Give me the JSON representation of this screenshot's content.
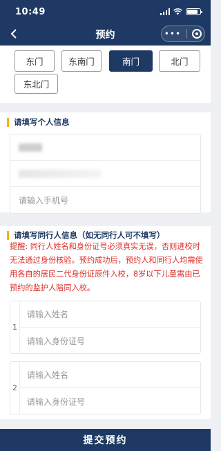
{
  "status": {
    "time": "10:49"
  },
  "nav": {
    "title": "预约",
    "more_label": "•••"
  },
  "gates": {
    "options": [
      "东门",
      "东南门",
      "南门",
      "北门",
      "东北门"
    ],
    "selected": "南门"
  },
  "personal": {
    "title": "请填写个人信息",
    "phone_placeholder": "请输入手机号"
  },
  "companion": {
    "title": "请填写同行人信息（如无同行人可不填写）",
    "notice": "提醒: 同行人姓名和身份证号必须真实无误，否则进校时无法通过身份核验。预约成功后，预约人和同行人均需使用各自的居民二代身份证原件入校，8岁以下儿童需由已预约的监护人陪同入校。",
    "entries": [
      {
        "index": "1",
        "name_placeholder": "请输入姓名",
        "id_placeholder": "请输入身份证号"
      },
      {
        "index": "2",
        "name_placeholder": "请输入姓名",
        "id_placeholder": "请输入身份证号"
      }
    ]
  },
  "submit_label": "提交预约",
  "colors": {
    "primary": "#1e3a64",
    "accent": "#f2b300",
    "warning": "#d9302c"
  }
}
